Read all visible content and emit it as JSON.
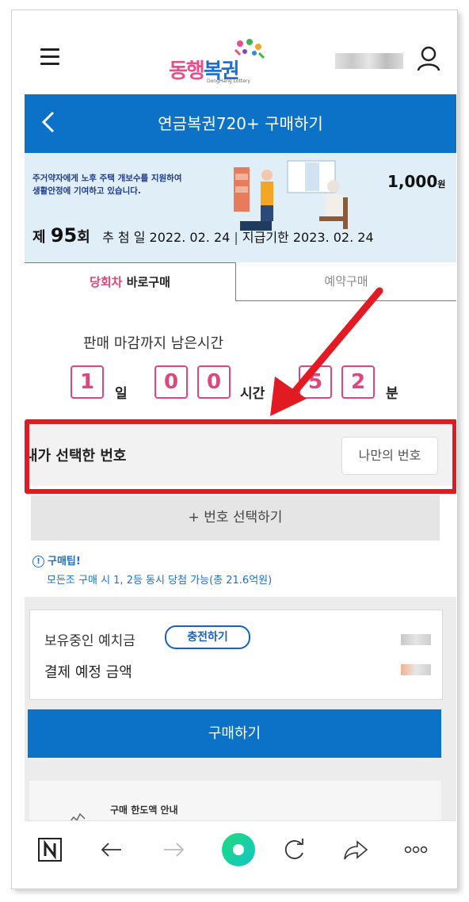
{
  "appbar": {
    "logo_text": "동행복권",
    "logo_sub": "DongHang Lottery"
  },
  "header": {
    "title": "연금복권720+ 구매하기"
  },
  "banner": {
    "description": "주거약자에게 노후 주택 개보수를 지원하여\n생활안정에 기여하고 있습니다.",
    "price": "1,000",
    "price_unit": "원",
    "round_prefix": "제",
    "round_number": "95",
    "round_suffix": "회",
    "draw_date_label": "추 첨 일",
    "draw_date": "2022. 02. 24",
    "deadline_label": "지급기한",
    "deadline": "2023. 02. 24"
  },
  "tabs": {
    "active_highlight": "당회차",
    "active_rest": " 바로구매",
    "inactive": "예약구매"
  },
  "countdown": {
    "label": "판매 마감까지 남은시간",
    "days": "1",
    "days_unit": "일",
    "hour_tens": "0",
    "hour_ones": "0",
    "hour_unit": "시간",
    "min_tens": "5",
    "min_ones": "2",
    "min_unit": "분"
  },
  "selection": {
    "title": "내가 선택한 번호",
    "my_number_button": "나만의 번호",
    "add_number_button": "+ 번호 선택하기"
  },
  "tip": {
    "title": "구매팁!",
    "text": "모든조 구매 시 1, 2등 동시 당첨 가능(총 21.6억원)"
  },
  "deposit": {
    "balance_label": "보유중인 예치금",
    "charge_button": "충전하기",
    "payment_label": "결제 예정 금액"
  },
  "purchase": {
    "button": "구매하기"
  },
  "limit": {
    "text": "구매 한도액 안내"
  },
  "colors": {
    "brand_blue": "#0b72c7",
    "accent_pink": "#e0457b",
    "highlight_red": "#e21b23"
  }
}
